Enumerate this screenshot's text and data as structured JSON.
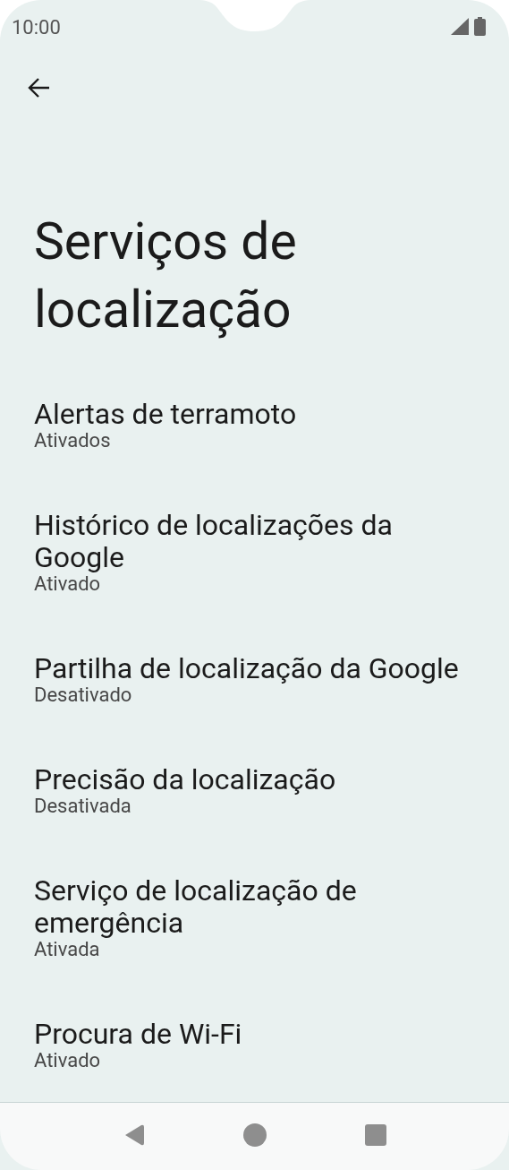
{
  "status_bar": {
    "time": "10:00"
  },
  "title": "Serviços de localização",
  "items": [
    {
      "title": "Alertas de terramoto",
      "subtitle": "Ativados"
    },
    {
      "title": "Histórico de localizações da Google",
      "subtitle": "Ativado"
    },
    {
      "title": "Partilha de localização da Google",
      "subtitle": "Desativado"
    },
    {
      "title": "Precisão da localização",
      "subtitle": "Desativada"
    },
    {
      "title": "Serviço de localização de emergência",
      "subtitle": "Ativada"
    },
    {
      "title": "Procura de Wi-Fi",
      "subtitle": "Ativado"
    }
  ]
}
